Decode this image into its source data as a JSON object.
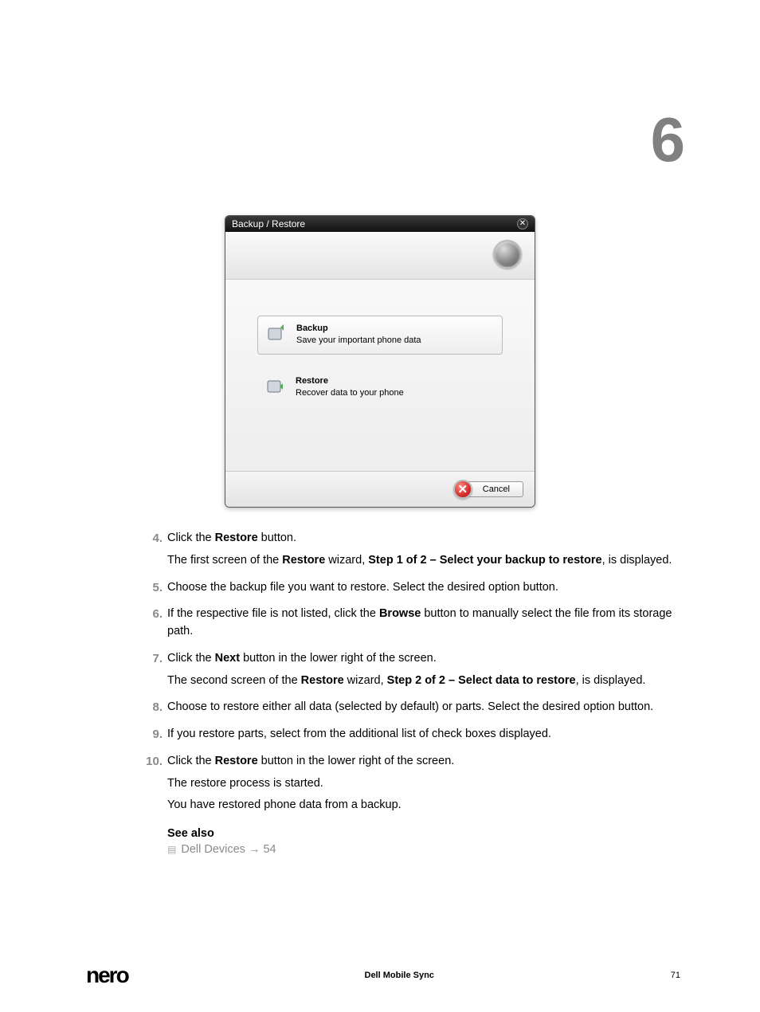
{
  "chapter_number": "6",
  "dialog": {
    "title": "Backup / Restore",
    "options": [
      {
        "title": "Backup",
        "desc": "Save your important phone data"
      },
      {
        "title": "Restore",
        "desc": "Recover data to your phone"
      }
    ],
    "cancel": "Cancel"
  },
  "steps": [
    {
      "n": "4.",
      "lines": [
        "Click the <b>Restore</b> button.",
        "The first screen of the <b>Restore</b> wizard, <b>Step 1 of 2 – Select your backup to restore</b>, is displayed."
      ]
    },
    {
      "n": "5.",
      "lines": [
        "Choose the backup file you want to restore. Select the desired option button."
      ]
    },
    {
      "n": "6.",
      "lines": [
        "If the respective file is not listed, click the <b>Browse</b> button to manually select the file from its storage path."
      ]
    },
    {
      "n": "7.",
      "lines": [
        "Click the <b>Next</b> button in the lower right of the screen.",
        "The second screen of the <b>Restore</b> wizard, <b>Step 2 of 2 – Select data to restore</b>, is displayed."
      ]
    },
    {
      "n": "8.",
      "lines": [
        "Choose to restore either all data (selected by default) or parts. Select the desired option button."
      ]
    },
    {
      "n": "9.",
      "lines": [
        "If you restore parts, select from the additional list of check boxes displayed."
      ]
    },
    {
      "n": "10.",
      "lines": [
        "Click the <b>Restore</b> button in the lower right of the screen.",
        "The restore process is started.",
        "You have restored phone data from a backup."
      ]
    }
  ],
  "see_also": {
    "title": "See also",
    "link": "Dell Devices → 54"
  },
  "footer": {
    "logo": "nero",
    "center": "Dell Mobile Sync",
    "page": "71"
  }
}
